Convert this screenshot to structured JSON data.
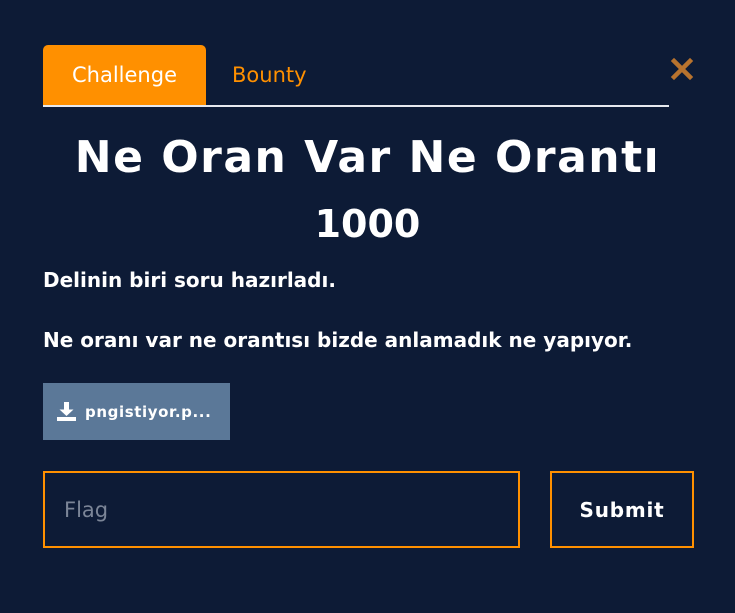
{
  "tabs": [
    {
      "label": "Challenge",
      "active": true
    },
    {
      "label": "Bounty",
      "active": false
    }
  ],
  "close_icon": "close-icon",
  "challenge": {
    "title": "Ne Oran Var Ne Orantı",
    "points": "1000",
    "description": [
      "Delinin biri soru hazırladı.",
      "Ne oranı var ne orantısı bizde anlamadık ne yapıyor."
    ],
    "file": {
      "icon": "download-icon",
      "name": "pngistiyor.p..."
    }
  },
  "flag": {
    "value": "",
    "placeholder": "Flag"
  },
  "submit_label": "Submit",
  "colors": {
    "background": "#0d1b36",
    "accent": "#ff9000",
    "file_button": "#5b7898",
    "tab_underline": "#e6e9ef",
    "close": "#b8732e"
  }
}
